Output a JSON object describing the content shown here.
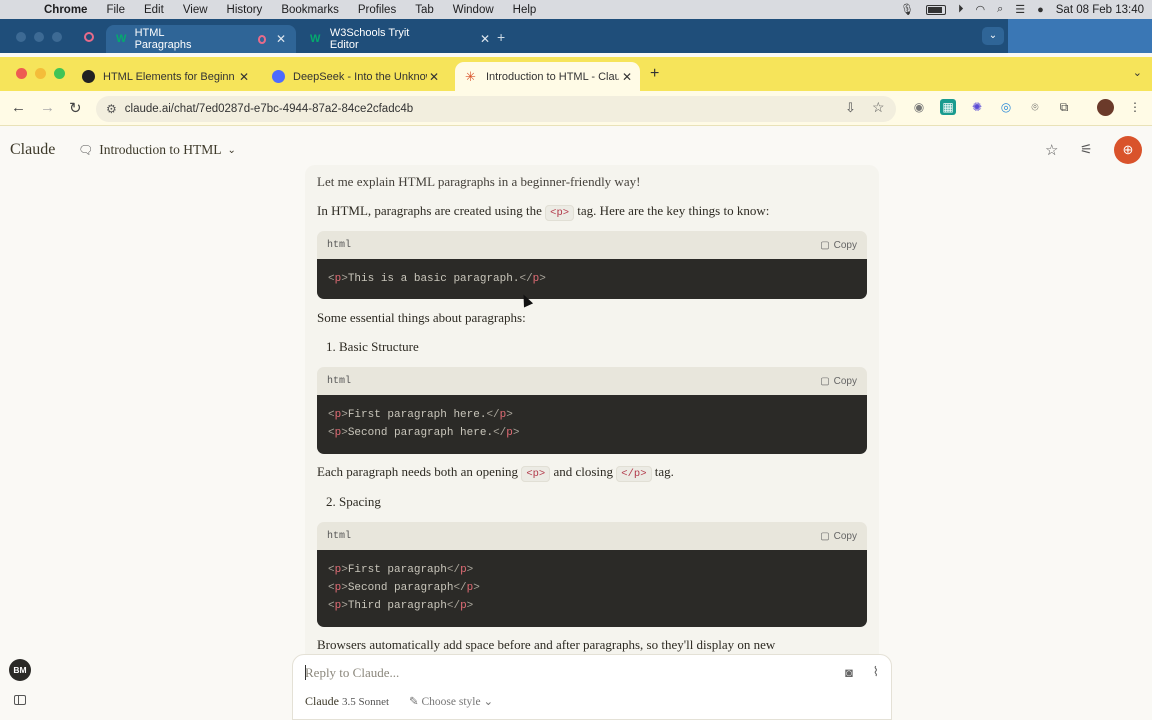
{
  "menubar": {
    "app": "Chrome",
    "items": [
      "File",
      "Edit",
      "View",
      "History",
      "Bookmarks",
      "Profiles",
      "Tab",
      "Window",
      "Help"
    ],
    "datetime": "Sat 08 Feb  13:40"
  },
  "back_window": {
    "tabs": [
      {
        "title": "HTML Paragraphs"
      },
      {
        "title": "W3Schools Tryit Editor"
      }
    ]
  },
  "browser": {
    "tabs": [
      {
        "title": "HTML Elements for Beginners",
        "favicon": "github-icon",
        "active": false
      },
      {
        "title": "DeepSeek - Into the Unknown",
        "favicon": "deepseek-icon",
        "active": false
      },
      {
        "title": "Introduction to HTML - Claude",
        "favicon": "claude-icon",
        "active": true
      }
    ],
    "url": "claude.ai/chat/7ed0287d-e7bc-4944-87a2-84ce2cfadc4b",
    "accent": "#f6e45a"
  },
  "claude": {
    "logo": "Claude",
    "chat_title": "Introduction to HTML",
    "feedback_color": "#d9532b"
  },
  "message": {
    "intro": "Let me explain HTML paragraphs in a beginner-friendly way!",
    "p1_a": "In HTML, paragraphs are created using the",
    "p1_code": "<p>",
    "p1_b": "tag. Here are the key things to know:",
    "code1": {
      "lang": "html",
      "copy": "Copy",
      "lines": [
        "<p>This is a basic paragraph.</p>"
      ]
    },
    "essentials": "Some essential things about paragraphs:",
    "list1": "1. Basic Structure",
    "code2": {
      "lang": "html",
      "copy": "Copy",
      "lines": [
        "<p>First paragraph here.</p>",
        "<p>Second paragraph here.</p>"
      ]
    },
    "p2_a": "Each paragraph needs both an opening",
    "p2_code1": "<p>",
    "p2_b": "and closing",
    "p2_code2": "</p>",
    "p2_c": "tag.",
    "list2": "2. Spacing",
    "code3": {
      "lang": "html",
      "copy": "Copy",
      "lines": [
        "<p>First paragraph</p>",
        "<p>Second paragraph</p>",
        "<p>Third paragraph</p>"
      ]
    },
    "cutoff": "Browsers automatically add space before and after paragraphs, so they'll display on new"
  },
  "reply": {
    "placeholder": "Reply to Claude...",
    "model": "Claude",
    "version": "3.5 Sonnet",
    "style": "Choose style"
  },
  "user": {
    "initials": "BM"
  }
}
